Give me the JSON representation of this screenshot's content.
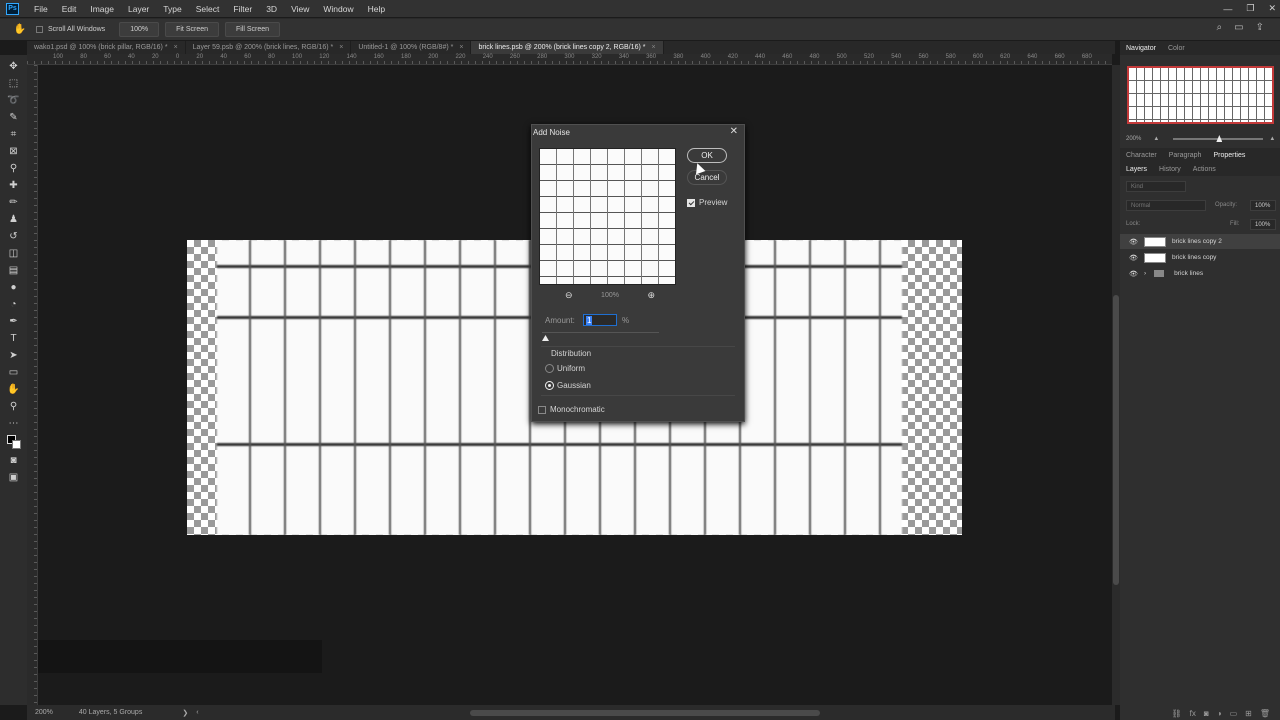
{
  "menubar": {
    "logo": "Ps",
    "items": [
      "File",
      "Edit",
      "Image",
      "Layer",
      "Type",
      "Select",
      "Filter",
      "3D",
      "View",
      "Window",
      "Help"
    ]
  },
  "options": {
    "scroll_all": "Scroll All Windows",
    "zoom": "100%",
    "fit": "Fit Screen",
    "fill": "Fill Screen"
  },
  "tabs": [
    {
      "label": "wako1.psd @ 100% (brick pillar, RGB/16) *"
    },
    {
      "label": "Layer 59.psb @ 200% (brick lines, RGB/16) *"
    },
    {
      "label": "Untitled-1 @ 100% (RGB/8#) *"
    },
    {
      "label": "brick lines.psb @ 200% (brick lines copy 2, RGB/16) *"
    }
  ],
  "ruler_numbers": [
    "100",
    "80",
    "60",
    "40",
    "20",
    "0",
    "20",
    "40",
    "60",
    "80",
    "100",
    "120",
    "140",
    "160",
    "180",
    "200",
    "220",
    "240",
    "260",
    "280",
    "300",
    "320",
    "340",
    "360",
    "380",
    "400",
    "420",
    "440",
    "460",
    "480",
    "500",
    "520",
    "540",
    "560",
    "580",
    "600",
    "620",
    "640",
    "660",
    "680"
  ],
  "dialog": {
    "title": "Add Noise",
    "ok": "OK",
    "cancel": "Cancel",
    "preview_label": "Preview",
    "zoom": "100%",
    "amount_label": "Amount:",
    "amount_value": "1",
    "amount_unit": "%",
    "distribution_label": "Distribution",
    "uniform": "Uniform",
    "gaussian": "Gaussian",
    "monochromatic": "Monochromatic",
    "preview_checked": true,
    "distribution_selected": "Gaussian",
    "monochromatic_checked": false
  },
  "status": {
    "zoom": "200%",
    "info": "40 Layers, 5 Groups"
  },
  "panels": {
    "navigator_tabs": [
      "Navigator",
      "Color"
    ],
    "nav_zoom": "200%",
    "props_tabs": [
      "Character",
      "Paragraph",
      "Properties"
    ],
    "layers_tabs": [
      "Layers",
      "History",
      "Actions"
    ],
    "kind": "Kind",
    "blend": "Normal",
    "opacity_label": "Opacity:",
    "opacity": "100%",
    "lock_label": "Lock:",
    "fill_label": "Fill:",
    "fill": "100%",
    "layers": [
      {
        "name": "brick lines copy 2",
        "selected": true,
        "type": "layer"
      },
      {
        "name": "brick lines copy",
        "selected": false,
        "type": "layer"
      },
      {
        "name": "brick lines",
        "selected": false,
        "type": "group"
      }
    ]
  },
  "colors": {
    "accent": "#31a8ff",
    "selection": "#1f6fd1",
    "nav_frame": "#c43a3a"
  }
}
